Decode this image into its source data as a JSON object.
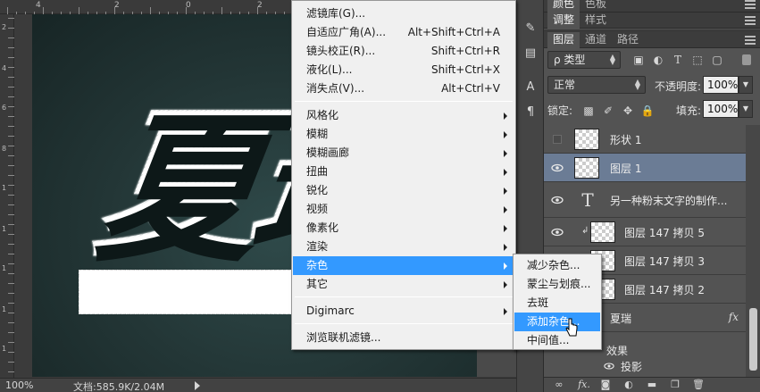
{
  "rulers": {
    "top_numbers": [
      "4",
      "2",
      "0",
      "2",
      "4",
      "6"
    ],
    "left_numbers": [
      "2",
      "4",
      "6",
      "8",
      "1",
      "1",
      "1",
      "1",
      "1"
    ]
  },
  "canvas": {
    "art_text": "夏瑞"
  },
  "status": {
    "zoom": "100%",
    "doc_info": "文档:585.9K/2.04M"
  },
  "menu": {
    "items": [
      {
        "label": "滤镜库(G)...",
        "shortcut": ""
      },
      {
        "label": "自适应广角(A)...",
        "shortcut": "Alt+Shift+Ctrl+A"
      },
      {
        "label": "镜头校正(R)...",
        "shortcut": "Shift+Ctrl+R"
      },
      {
        "label": "液化(L)...",
        "shortcut": "Shift+Ctrl+X"
      },
      {
        "label": "消失点(V)...",
        "shortcut": "Alt+Ctrl+V"
      },
      {
        "label": "风格化"
      },
      {
        "label": "模糊"
      },
      {
        "label": "模糊画廊"
      },
      {
        "label": "扭曲"
      },
      {
        "label": "锐化"
      },
      {
        "label": "视频"
      },
      {
        "label": "像素化"
      },
      {
        "label": "渲染"
      },
      {
        "label": "杂色"
      },
      {
        "label": "其它"
      },
      {
        "label": "Digimarc"
      },
      {
        "label": "浏览联机滤镜..."
      }
    ]
  },
  "submenu": {
    "items": [
      "减少杂色...",
      "蒙尘与划痕...",
      "去斑",
      "添加杂色...",
      "中间值..."
    ]
  },
  "panels": {
    "tabs_top": [
      "颜色",
      "色板"
    ],
    "tabs_mid": [
      "调整",
      "样式"
    ],
    "tabs_layers": [
      "图层",
      "通道",
      "路径"
    ],
    "filter_kind": "ρ 类型",
    "blend_mode": "正常",
    "opacity_label": "不透明度:",
    "opacity_value": "100%",
    "lock_label": "锁定:",
    "fill_label": "填充:",
    "fill_value": "100%",
    "layers": [
      {
        "name": "形状 1"
      },
      {
        "name": "图层 1"
      },
      {
        "name": "另一种粉末文字的制作..."
      },
      {
        "name": "图层 147 拷贝 5"
      },
      {
        "name": "图层 147 拷贝 3"
      },
      {
        "name": "图层 147 拷贝 2"
      },
      {
        "name": "夏瑞",
        "fx": "fx"
      }
    ],
    "effects_label": "效果",
    "effect_item": "投影",
    "footer_fx": "fx."
  },
  "icons": {
    "eye": "eye-icon",
    "submenu_arrow": "chevron-right-icon",
    "dropdown": "chevron-down-icon",
    "text_layer": "text-layer-icon"
  },
  "colors": {
    "menu_highlight": "#3399ff",
    "selected_layer": "#6b7c95",
    "panel_bg": "#535353"
  }
}
